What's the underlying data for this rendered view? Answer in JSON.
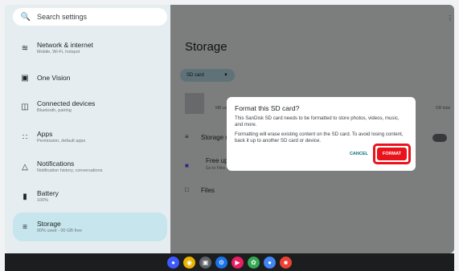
{
  "search": {
    "placeholder": "Search settings",
    "icon": "search-icon"
  },
  "sidebar": {
    "items": [
      {
        "title": "Network & internet",
        "subtitle": "Mobile, Wi-Fi, hotspot",
        "icon": "wifi-icon"
      },
      {
        "title": "One Vision",
        "subtitle": "",
        "icon": "square-icon"
      },
      {
        "title": "Connected devices",
        "subtitle": "Bluetooth, pairing",
        "icon": "devices-icon"
      },
      {
        "title": "Apps",
        "subtitle": "Permission, default apps",
        "icon": "apps-grid-icon"
      },
      {
        "title": "Notifications",
        "subtitle": "Notification history, conversations",
        "icon": "bell-icon"
      },
      {
        "title": "Battery",
        "subtitle": "100%",
        "icon": "battery-icon"
      },
      {
        "title": "Storage",
        "subtitle": "00% used - 00 GB free",
        "icon": "storage-icon"
      }
    ]
  },
  "main": {
    "title": "Storage",
    "storage_selector": "SD card",
    "storage_label": "Storage m",
    "free_up_title": "Free up",
    "free_up_subtitle": "Go to Files app to manage and free up space",
    "files_label": "Files",
    "ms_label": "MB us",
    "gb_total": "GB total"
  },
  "dialog": {
    "title": "Format this SD card?",
    "body1": "This SanDisk SD card needs to be formatted to store photos, videos, music, and more.",
    "body2": "Formatting will erase existing content on the SD card. To avoid losing content, back it up to another SD card or device.",
    "cancel": "CANCEL",
    "format": "FORMAT"
  },
  "colors": {
    "accent": "#0b6d80",
    "highlight": "#e8131c",
    "selected_bg": "#c6e5ec"
  },
  "taskbar": {
    "apps": [
      {
        "name": "launcher-icon",
        "color": "#3d5afe"
      },
      {
        "name": "chrome-icon",
        "color": "#e8b400"
      },
      {
        "name": "camera-icon",
        "color": "#5f6368"
      },
      {
        "name": "settings-icon",
        "color": "#1a73e8"
      },
      {
        "name": "media-icon",
        "color": "#e91e63"
      },
      {
        "name": "photos-icon",
        "color": "#34a853"
      },
      {
        "name": "assistant-icon",
        "color": "#4285f4"
      },
      {
        "name": "games-icon",
        "color": "#ea4335"
      }
    ]
  }
}
